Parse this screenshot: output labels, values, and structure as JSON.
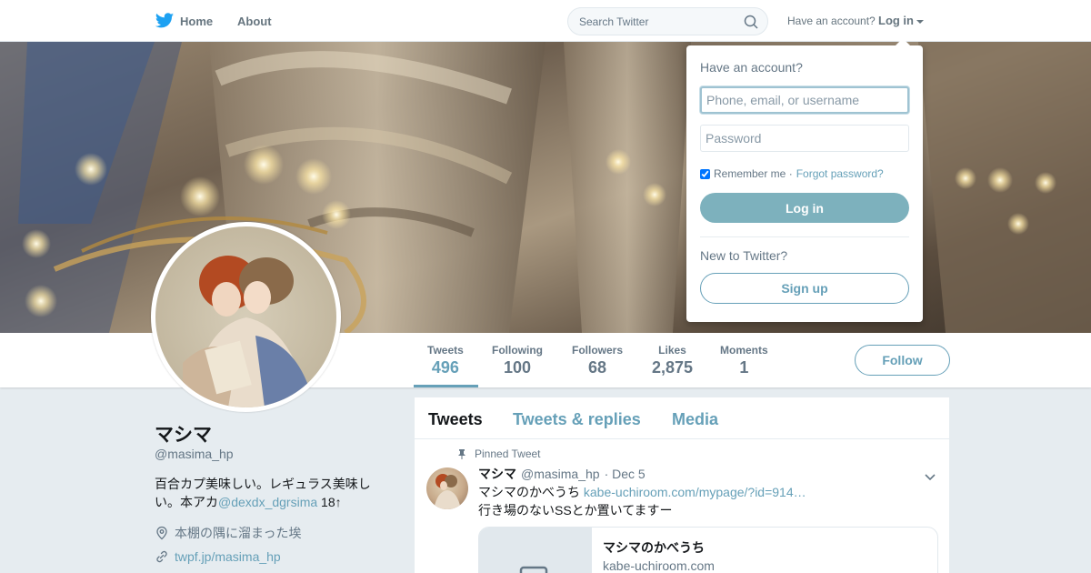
{
  "nav": {
    "home_label": "Home",
    "about_label": "About",
    "search_placeholder": "Search Twitter",
    "have_account": "Have an account?",
    "login_label": "Log in"
  },
  "profile": {
    "name": "マシマ",
    "handle": "@masima_hp",
    "bio_text": "百合カプ美味しい。レギュラス美味しい。本アカ",
    "bio_link": "@dexdx_dgrsima",
    "bio_suffix": " 18↑",
    "location": "本棚の隅に溜まった埃",
    "url": "twpf.jp/masima_hp",
    "follow_label": "Follow"
  },
  "stats": [
    {
      "label": "Tweets",
      "value": "496"
    },
    {
      "label": "Following",
      "value": "100"
    },
    {
      "label": "Followers",
      "value": "68"
    },
    {
      "label": "Likes",
      "value": "2,875"
    },
    {
      "label": "Moments",
      "value": "1"
    }
  ],
  "timeline": {
    "tabs": [
      "Tweets",
      "Tweets & replies",
      "Media"
    ],
    "pinned_label": "Pinned Tweet",
    "tweet": {
      "name": "マシマ",
      "handle": "@masima_hp",
      "date": "· Dec 5",
      "text_prefix": "マシマのかべうち ",
      "link": "kabe-uchiroom.com/mypage/?id=914…",
      "text_line2": "行き場のないSSとか置いてますー",
      "card_title": "マシマのかべうち",
      "card_domain": "kabe-uchiroom.com"
    }
  },
  "login_dropdown": {
    "title": "Have an account?",
    "username_placeholder": "Phone, email, or username",
    "password_placeholder": "Password",
    "remember_label": "Remember me ·",
    "forgot_label": "Forgot password?",
    "login_button": "Log in",
    "new_label": "New to Twitter?",
    "signup_button": "Sign up"
  },
  "colors": {
    "accent": "#66a0b8",
    "login_button": "#7db1bd",
    "twitter_blue": "#1da1f2"
  }
}
